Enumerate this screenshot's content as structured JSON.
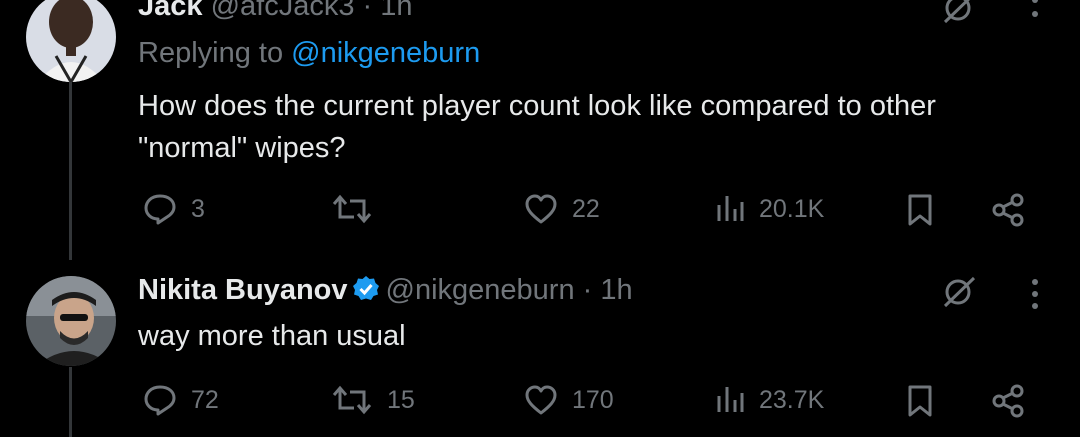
{
  "tweets": [
    {
      "name": "Jack",
      "handle": "@afcJack3 · 1h",
      "replying_prefix": "Replying to ",
      "replying_to": "@nikgeneburn",
      "text_line1": "How does the current player count look like compared to other",
      "text_line2": "\"normal\" wipes?",
      "replies": "3",
      "retweets": "",
      "likes": "22",
      "views": "20.1K"
    },
    {
      "name": "Nikita Buyanov",
      "handle": "@nikgeneburn · 1h",
      "verified": true,
      "text_line1": "way more than usual",
      "replies": "72",
      "retweets": "15",
      "likes": "170",
      "views": "23.7K"
    }
  ],
  "icons": [
    "reply-icon",
    "retweet-icon",
    "like-icon",
    "views-icon",
    "bookmark-icon",
    "share-icon",
    "grok-icon",
    "more-icon",
    "verified-badge-icon"
  ],
  "colors": {
    "background": "#000000",
    "text": "#e7e9ea",
    "muted": "#71767b",
    "link": "#1d9bf0",
    "verified": "#1d9bf0"
  }
}
